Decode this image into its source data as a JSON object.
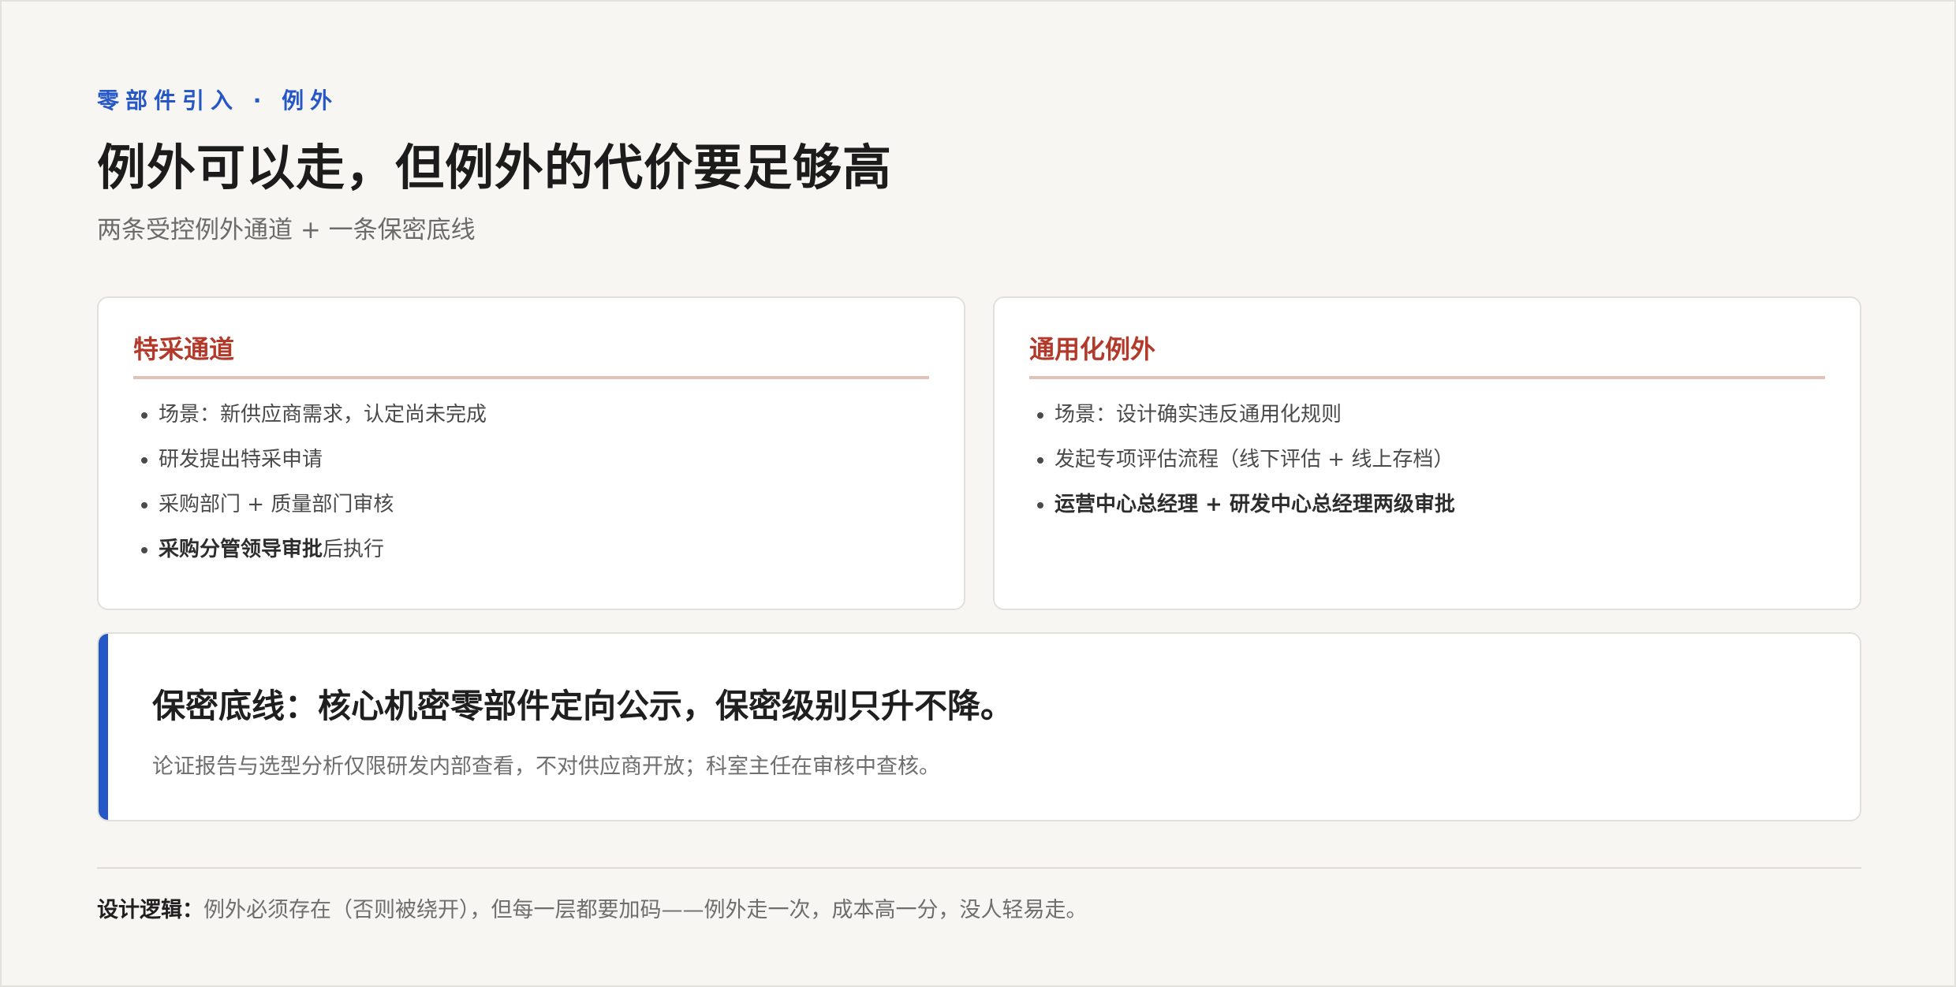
{
  "header": {
    "eyebrow": "零部件引入 · 例外",
    "title": "例外可以走，但例外的代价要足够高",
    "subtitle": "两条受控例外通道 + 一条保密底线"
  },
  "cards": [
    {
      "title": "特采通道",
      "items": [
        {
          "bold": "",
          "text": "场景：新供应商需求，认定尚未完成"
        },
        {
          "bold": "",
          "text": "研发提出特采申请"
        },
        {
          "bold": "",
          "text": "采购部门 + 质量部门审核"
        },
        {
          "bold": "采购分管领导审批",
          "text": "后执行"
        }
      ]
    },
    {
      "title": "通用化例外",
      "items": [
        {
          "bold": "",
          "text": "场景：设计确实违反通用化规则"
        },
        {
          "bold": "",
          "text": "发起专项评估流程（线下评估 + 线上存档）"
        },
        {
          "bold": "运营中心总经理 + 研发中心总经理两级审批",
          "text": ""
        }
      ]
    }
  ],
  "callout": {
    "title": "保密底线：核心机密零部件定向公示，保密级别只升不降。",
    "text": "论证报告与选型分析仅限研发内部查看，不对供应商开放；科室主任在审核中查核。"
  },
  "footnote": {
    "label": "设计逻辑：",
    "text": "例外必须存在（否则被绕开），但每一层都要加码——例外走一次，成本高一分，没人轻易走。"
  },
  "colors": {
    "accent_blue": "#2557c6",
    "accent_red": "#b33a2b",
    "background": "#f7f6f3"
  }
}
